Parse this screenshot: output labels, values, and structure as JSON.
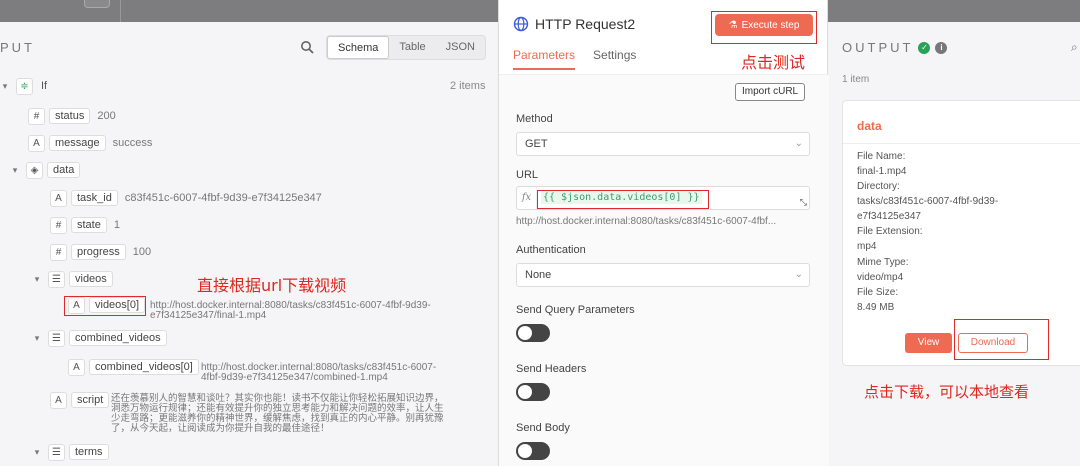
{
  "left_panel": {
    "title": "PUT",
    "view_tabs": [
      "Schema",
      "Table",
      "JSON"
    ],
    "active_view": "Schema",
    "items_count": "2 items",
    "tree": {
      "root": "If",
      "status_key": "status",
      "status_val": "200",
      "message_key": "message",
      "message_val": "success",
      "data_key": "data",
      "task_id_key": "task_id",
      "task_id_val": "c83f451c-6007-4fbf-9d39-e7f34125e347",
      "state_key": "state",
      "state_val": "1",
      "progress_key": "progress",
      "progress_val": "100",
      "videos_key": "videos",
      "videos0_key": "videos[0]",
      "videos0_val_1": "http://host.docker.internal:8080/tasks/c83f451c-6007-4fbf-9d39-",
      "videos0_val_2": "e7f34125e347/final-1.mp4",
      "combined_key": "combined_videos",
      "combined0_key": "combined_videos[0]",
      "combined0_val_1": "http://host.docker.internal:8080/tasks/c83f451c-6007-",
      "combined0_val_2": "4fbf-9d39-e7f34125e347/combined-1.mp4",
      "script_key": "script",
      "script_val_1": "还在羡慕别人的智慧和谈吐？其实你也能！读书不仅能让你轻松拓展知识边界，",
      "script_val_2": "洞悉万物运行规律；还能有效提升你的独立思考能力和解决问题的效率，让人生",
      "script_val_3": "少走弯路；更能滋养你的精神世界，缓解焦虑，找到真正的内心平静。别再犹豫",
      "script_val_4": "了，从今天起，让阅读成为你提升自我的最佳途径！",
      "terms_key": "terms"
    },
    "annotation_videos": "直接根据url下载视频"
  },
  "node_panel": {
    "title": "HTTP Request2",
    "execute_label": "Execute step",
    "annotation_execute": "点击测试",
    "tabs": [
      "Parameters",
      "Settings"
    ],
    "active_tab": "Parameters",
    "import_curl": "Import cURL",
    "method_label": "Method",
    "method_value": "GET",
    "url_label": "URL",
    "url_expression": "{{ $json.data.videos[0] }}",
    "url_preview": "http://host.docker.internal:8080/tasks/c83f451c-6007-4fbf...",
    "auth_label": "Authentication",
    "auth_value": "None",
    "send_query_label": "Send Query Parameters",
    "send_headers_label": "Send Headers",
    "send_body_label": "Send Body",
    "send_query_on": false,
    "send_headers_on": false,
    "send_body_on": false
  },
  "output_panel": {
    "title": "OUTPUT",
    "items_count": "1 item",
    "card_title": "data",
    "file_name_label": "File Name:",
    "file_name": "final-1.mp4",
    "directory_label": "Directory:",
    "directory_1": "tasks/c83f451c-6007-4fbf-9d39-",
    "directory_2": "e7f34125e347",
    "ext_label": "File Extension:",
    "ext": "mp4",
    "mime_label": "Mime Type:",
    "mime": "video/mp4",
    "size_label": "File Size:",
    "size": "8.49 MB",
    "view_label": "View",
    "download_label": "Download",
    "annotation_download": "点击下载，可以本地查看"
  },
  "colors": {
    "accent": "#ef6a52",
    "annotation_red": "#e0261f",
    "success": "#2aa15b"
  }
}
